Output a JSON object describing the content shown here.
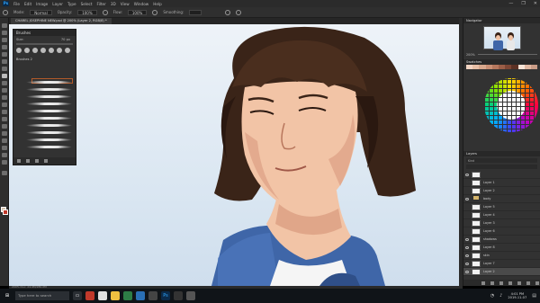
{
  "app": {
    "menu": [
      "File",
      "Edit",
      "Image",
      "Layer",
      "Type",
      "Select",
      "Filter",
      "3D",
      "View",
      "Window",
      "Help"
    ],
    "window_controls": [
      "—",
      "❐",
      "✕"
    ]
  },
  "options_bar": {
    "mode_label": "Mode:",
    "mode_value": "Normal",
    "opacity_label": "Opacity:",
    "opacity_value": "100%",
    "flow_label": "Flow:",
    "flow_value": "100%",
    "smoothing_label": "Smoothing:"
  },
  "document": {
    "tab_title": "CHAREL JOSEPHINE NEW.psd @ 200% (Layer 2, RGB/8) *"
  },
  "brushes_panel": {
    "title": "Brushes",
    "size_label": "Size:",
    "size_value": "70 px",
    "group_label": "Brushes 2"
  },
  "navigator_panel": {
    "title": "Navigator",
    "zoom": "200%"
  },
  "swatches_panel": {
    "title": "Swatches",
    "colors": [
      "#f2d4c2",
      "#e8bfa6",
      "#d9a88d",
      "#c98f74",
      "#b5775d",
      "#9b5e47",
      "#7d4634",
      "#5c3124",
      "#f7e3d6",
      "#e0b7a1",
      "#c99c86"
    ]
  },
  "layers_panel": {
    "title": "Layers",
    "kind_label": "Kind",
    "rows": [
      {
        "name": "",
        "type": "layer",
        "visible": true,
        "active": false
      },
      {
        "name": "Layer 1",
        "type": "layer",
        "visible": false,
        "active": false
      },
      {
        "name": "Layer 2",
        "type": "layer",
        "visible": false,
        "active": false
      },
      {
        "name": "body",
        "type": "folder",
        "visible": true,
        "active": false
      },
      {
        "name": "Layer 5",
        "type": "layer",
        "visible": false,
        "active": false
      },
      {
        "name": "Layer 4",
        "type": "layer",
        "visible": false,
        "active": false
      },
      {
        "name": "Layer 3",
        "type": "layer",
        "visible": false,
        "active": false
      },
      {
        "name": "Layer 6",
        "type": "layer",
        "visible": false,
        "active": false
      },
      {
        "name": "shadows",
        "type": "layer",
        "visible": true,
        "active": false
      },
      {
        "name": "Layer 8",
        "type": "layer",
        "visible": true,
        "active": false
      },
      {
        "name": "skin",
        "type": "layer",
        "visible": true,
        "active": false
      },
      {
        "name": "Layer 7",
        "type": "layer",
        "visible": true,
        "active": false
      },
      {
        "name": "Layer 2",
        "type": "layer",
        "visible": true,
        "active": true
      }
    ]
  },
  "status_bar": {
    "zoom": "200%",
    "doc_size": "Doc: 24.9M/280.0M"
  },
  "taskbar": {
    "search_placeholder": "Type here to search",
    "time": "4:01 PM",
    "date": "2019-11-07"
  }
}
